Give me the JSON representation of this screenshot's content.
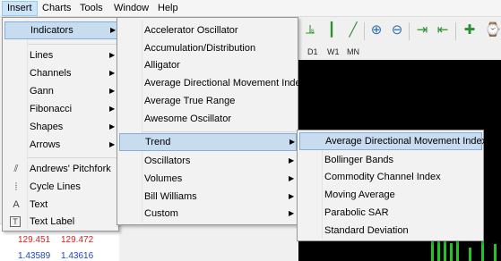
{
  "menubar": [
    "Insert",
    "Charts",
    "Tools",
    "Window",
    "Help"
  ],
  "toolbar": {
    "timeframes": [
      "D1",
      "W1",
      "MN"
    ],
    "icons": [
      "bar-chart-icon",
      "zoom-in-icon",
      "zoom-out-icon",
      "chart-shift-icon",
      "autoscroll-icon",
      "periods-icon",
      "indicator-list-icon",
      "history-center-icon"
    ]
  },
  "insert_menu": {
    "items": [
      {
        "label": "Indicators",
        "submenu": true
      },
      {
        "label": "Lines",
        "submenu": true
      },
      {
        "label": "Channels",
        "submenu": true
      },
      {
        "label": "Gann",
        "submenu": true
      },
      {
        "label": "Fibonacci",
        "submenu": true
      },
      {
        "label": "Shapes",
        "submenu": true
      },
      {
        "label": "Arrows",
        "submenu": true
      },
      {
        "label": "Andrews' Pitchfork",
        "icon": "pitchfork-icon"
      },
      {
        "label": "Cycle Lines",
        "icon": "cycle-lines-icon"
      },
      {
        "label": "Text",
        "icon": "text-icon"
      },
      {
        "label": "Text Label",
        "icon": "text-label-icon"
      }
    ],
    "icon_glyphs": [
      "⫽",
      "⦙",
      "A",
      "T"
    ]
  },
  "indicators_menu": {
    "items": [
      {
        "label": "Accelerator Oscillator"
      },
      {
        "label": "Accumulation/Distribution"
      },
      {
        "label": "Alligator"
      },
      {
        "label": "Average Directional Movement Index"
      },
      {
        "label": "Average True Range"
      },
      {
        "label": "Awesome Oscillator"
      },
      {
        "label": "Trend",
        "submenu": true
      },
      {
        "label": "Oscillators",
        "submenu": true
      },
      {
        "label": "Volumes",
        "submenu": true
      },
      {
        "label": "Bill Williams",
        "submenu": true
      },
      {
        "label": "Custom",
        "submenu": true
      }
    ]
  },
  "trend_menu": {
    "items": [
      {
        "label": "Average Directional Movement Index"
      },
      {
        "label": "Bollinger Bands"
      },
      {
        "label": "Commodity Channel Index"
      },
      {
        "label": "Moving Average"
      },
      {
        "label": "Parabolic SAR"
      },
      {
        "label": "Standard Deviation"
      }
    ]
  },
  "quotes": [
    {
      "bid": "129.451",
      "ask": "129.472"
    },
    {
      "bid": "1.43589",
      "ask": "1.43616"
    }
  ],
  "colors": {
    "chart_bg": "#000000",
    "candle": "#22c522",
    "bid": "#e02020",
    "ask": "#1a44c8",
    "highlight": "#c8dcf0"
  }
}
